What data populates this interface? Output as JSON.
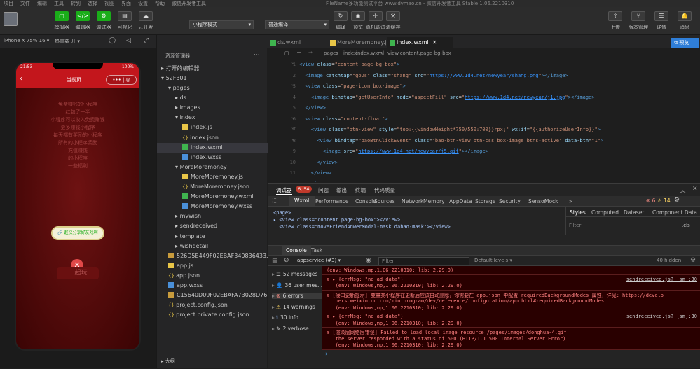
{
  "menubar": {
    "items": [
      "项目",
      "文件",
      "编辑",
      "工具",
      "转到",
      "选择",
      "视图",
      "界面",
      "设置",
      "帮助",
      "微信开发者工具"
    ],
    "title": "FileName多功能测试平台 www.dymao.cn - 微信开发者工具 Stable 1.06.2210310"
  },
  "toolbar": {
    "avatar": "avatar",
    "left_buttons": [
      {
        "icon": "▢",
        "label": "模拟器"
      },
      {
        "icon": "</>",
        "label": "编辑器"
      },
      {
        "icon": "⚙",
        "label": "调试器"
      },
      {
        "icon": "▤",
        "label": "可视化"
      },
      {
        "icon": "☁",
        "label": "云开发"
      }
    ],
    "mode_select": "小程序模式",
    "compile_select": "普通编译",
    "mid_buttons": [
      {
        "icon": "↻",
        "label": "编译"
      },
      {
        "icon": "◉",
        "label": "预览"
      },
      {
        "icon": "✈",
        "label": "真机调试"
      },
      {
        "icon": "⚒",
        "label": "清缓存"
      }
    ],
    "right_buttons": [
      {
        "icon": "⇪",
        "label": "上传"
      },
      {
        "icon": "⑂",
        "label": "版本管理"
      },
      {
        "icon": "☰",
        "label": "详情"
      },
      {
        "icon": "🔔",
        "label": "消息"
      }
    ]
  },
  "simulator": {
    "device": "iPhone X 75% 16 ▾",
    "network": "热重载 开 ▾",
    "status_time": "21:53",
    "status_batt": "100%",
    "nav_title": "当前页",
    "texts": [
      "免费赚钱的小程序",
      "红包了一半",
      "小程序可以收入免费赚钱",
      "更多赚钱小程序",
      "每天都有奖励的小程序",
      "所有的小程序奖励",
      "充值赚钱",
      "的小程序",
      "一些福利"
    ],
    "share_btn": "🔗 赶快分享好友戏啊",
    "bottom_btn": "一起玩"
  },
  "explorer": {
    "header": "资源管理器",
    "more": "···",
    "open_editors": "打开的编辑器",
    "project": "52F301",
    "tree": [
      {
        "depth": 1,
        "type": "folder",
        "open": true,
        "name": "pages"
      },
      {
        "depth": 2,
        "type": "folder",
        "open": false,
        "name": "ds"
      },
      {
        "depth": 2,
        "type": "folder",
        "open": false,
        "name": "images"
      },
      {
        "depth": 2,
        "type": "folder",
        "open": true,
        "name": "index"
      },
      {
        "depth": 3,
        "type": "js",
        "name": "index.js"
      },
      {
        "depth": 3,
        "type": "json",
        "name": "index.json"
      },
      {
        "depth": 3,
        "type": "wxml",
        "name": "index.wxml",
        "selected": true
      },
      {
        "depth": 3,
        "type": "wxss",
        "name": "index.wxss"
      },
      {
        "depth": 2,
        "type": "folder",
        "open": true,
        "name": "MoreMoremoney"
      },
      {
        "depth": 3,
        "type": "js",
        "name": "MoreMoremoney.js"
      },
      {
        "depth": 3,
        "type": "json",
        "name": "MoreMoremoney.json"
      },
      {
        "depth": 3,
        "type": "wxml",
        "name": "MoreMoremoney.wxml"
      },
      {
        "depth": 3,
        "type": "wxss",
        "name": "MoreMoremoney.wxss"
      },
      {
        "depth": 2,
        "type": "folder",
        "open": false,
        "name": "mywish"
      },
      {
        "depth": 2,
        "type": "folder",
        "open": false,
        "name": "sendreceived"
      },
      {
        "depth": 2,
        "type": "folder",
        "open": false,
        "name": "template"
      },
      {
        "depth": 2,
        "type": "folder",
        "open": false,
        "name": "wishdetail"
      },
      {
        "depth": 1,
        "type": "img",
        "name": "526D5E449F02EBAF340836433..."
      },
      {
        "depth": 1,
        "type": "js",
        "name": "app.js"
      },
      {
        "depth": 1,
        "type": "json",
        "name": "app.json"
      },
      {
        "depth": 1,
        "type": "wxss",
        "name": "app.wxss"
      },
      {
        "depth": 1,
        "type": "img",
        "name": "C15640D09F02EBAFA73028D76..."
      },
      {
        "depth": 1,
        "type": "json",
        "name": "project.config.json"
      },
      {
        "depth": 1,
        "type": "json",
        "name": "project.private.config.json"
      }
    ],
    "outline": "大纲"
  },
  "editor": {
    "tabs": [
      {
        "name": "ds.wxml",
        "type": "wxml"
      },
      {
        "name": "MoreMoremoney.js",
        "type": "js"
      },
      {
        "name": "index.wxml",
        "type": "wxml",
        "active": true,
        "close": "✕"
      }
    ],
    "breadcrumb": [
      "pages",
      "index",
      "index.wxml",
      "view.content.page-bg-box"
    ],
    "lines": [
      {
        "n": "1",
        "html": "<span class='t'>&lt;view</span> <span class='a'>class</span>=<span class='s'>\"content page-bg-box\"</span><span class='t'>&gt;</span>"
      },
      {
        "n": "2",
        "html": "&nbsp;&nbsp;<span class='t'>&lt;image</span> <span class='a'>catchtap</span>=<span class='s'>\"goDs\"</span> <span class='a'>class</span>=<span class='s'>\"shang\"</span> <span class='a'>src</span>=<span class='s'>\"</span><span class='l'>https://www.1d4.net/newyear/shang.png</span><span class='s'>\"</span><span class='t'>&gt;&lt;/image&gt;</span>"
      },
      {
        "n": "3",
        "html": "&nbsp;&nbsp;<span class='t'>&lt;view</span> <span class='a'>class</span>=<span class='s'>\"page-icon box-image\"</span><span class='t'>&gt;</span>"
      },
      {
        "n": "4",
        "html": "&nbsp;&nbsp;&nbsp;&nbsp;<span class='t'>&lt;image</span> <span class='a'>bindtap</span>=<span class='s'>\"getUserInfo\"</span> <span class='a'>mode</span>=<span class='s'>\"aspectFill\"</span> <span class='a'>src</span>=<span class='s'>\"</span><span class='l'>https://www.1d4.net/newyear/j1.jpg</span><span class='s'>\"</span><span class='t'>&gt;&lt;/image&gt;</span>"
      },
      {
        "n": "5",
        "html": "&nbsp;&nbsp;<span class='t'>&lt;/view&gt;</span>"
      },
      {
        "n": "6",
        "html": "&nbsp;&nbsp;<span class='t'>&lt;view</span> <span class='a'>class</span>=<span class='s'>\"content-float\"</span><span class='t'>&gt;</span>"
      },
      {
        "n": "7",
        "html": "&nbsp;&nbsp;&nbsp;&nbsp;<span class='t'>&lt;view</span> <span class='a'>class</span>=<span class='s'>\"btn-view\"</span> <span class='a'>style</span>=<span class='s'>\"top:{{windowHeight*750/550:700}}rpx;\"</span> <span class='a'>wx:if</span>=<span class='s'>\"{{authorizeUserInfo}}\"</span><span class='t'>&gt;</span>"
      },
      {
        "n": "8",
        "html": "&nbsp;&nbsp;&nbsp;&nbsp;&nbsp;&nbsp;<span class='t'>&lt;view</span> <span class='a'>bindtap</span>=<span class='s'>\"baoBtnClickEvent\"</span> <span class='a'>class</span>=<span class='s'>\"bao-btn-view btn-css box-image btns-active\"</span> <span class='a'>data-btn</span>=<span class='s'>\"1\"</span><span class='t'>&gt;</span>"
      },
      {
        "n": "9",
        "html": "&nbsp;&nbsp;&nbsp;&nbsp;&nbsp;&nbsp;&nbsp;&nbsp;<span class='t'>&lt;image</span> <span class='a'>src</span>=<span class='s'>\"</span><span class='l'>https://www.1d4.net/newyear/j5.gif</span><span class='s'>\"</span><span class='t'>&gt;&lt;/image&gt;</span>"
      },
      {
        "n": "10",
        "html": "&nbsp;&nbsp;&nbsp;&nbsp;&nbsp;&nbsp;<span class='t'>&lt;/view&gt;</span>"
      },
      {
        "n": "11",
        "html": "&nbsp;&nbsp;&nbsp;&nbsp;<span class='t'>&lt;/view&gt;</span>"
      },
      {
        "n": "12",
        "html": "&nbsp;&nbsp;<span class='t'>&lt;/view&gt;</span>"
      }
    ]
  },
  "devtools": {
    "top_tabs": [
      "调试器",
      "问题",
      "输出",
      "终端",
      "代码质量"
    ],
    "badge": "6, 54",
    "panel_tabs": [
      "Wxml",
      "Performance",
      "Console",
      "Sources",
      "Network",
      "Memory",
      "AppData",
      "Storage",
      "Security",
      "Sensor",
      "Mock",
      "»"
    ],
    "err_count": "6",
    "warn_count": "14",
    "wxml_lines": [
      "<page>",
      "▸ <view class=\"content page-bg-box\"></view>",
      "  <view class=\"moveFriendAnwerModal-mask dabao-mask\"></view>"
    ],
    "style_tabs": [
      "Styles",
      "Computed",
      "Dataset",
      "Component Data"
    ],
    "filter_placeholder": "Filter",
    "cls": ".cls",
    "console_tabs": [
      "Console",
      "Task"
    ],
    "context": "appservice (#3)",
    "console_filter": "Filter",
    "levels": "Default levels ▾",
    "hidden": "40 hidden",
    "sidebar": [
      {
        "icon": "☰",
        "label": "52 messages",
        "color": "#cfcfcf"
      },
      {
        "icon": "👤",
        "label": "36 user mes...",
        "color": "#cfcfcf"
      },
      {
        "icon": "⊗",
        "label": "6 errors",
        "color": "#f28b82"
      },
      {
        "icon": "⚠",
        "label": "14 warnings",
        "color": "#fdd663"
      },
      {
        "icon": "ℹ",
        "label": "30 info",
        "color": "#8ab4f8"
      },
      {
        "icon": "✎",
        "label": "2 verbose",
        "color": "#cfcfcf"
      }
    ],
    "messages": [
      {
        "lines": [
          "(env: Windows,mp,1.06.2210310; lib: 2.29.0)"
        ],
        "src": ""
      },
      {
        "lines": [
          "⊗ ▸ {errMsg: \"no ad data\"}",
          "   (env: Windows,mp,1.06.2210310; lib: 2.29.0)"
        ],
        "src": "sendreceived.js? [sm]:30"
      },
      {
        "lines": [
          "⊗ [接口更新提示] 变量类小程序在更新后应该自动删除，你需要在 app.json 中配置 requiredBackgroundModes 属性，详见: https://develo",
          "   pers.weixin.qq.com/miniprogram/dev/reference/configuration/app.html#requiredBackgroundModes",
          "   (env: Windows,mp,1.06.2210310; lib: 2.29.0)"
        ],
        "src": ""
      },
      {
        "lines": [
          "⊗ ▸ {errMsg: \"no ad data\"}",
          "   (env: Windows,mp,1.06.2210310; lib: 2.29.0)"
        ],
        "src": "sendreceived.js? [sm]:30"
      },
      {
        "lines": [
          "⊗ [渲染层网络层错误] Failed to load local image resource /pages/images/donghua-4.gif",
          "   the server responded with a status of 500 (HTTP/1.1 500 Internal Server Error)",
          "   (env: Windows,mp,1.06.2210310; lib: 2.29.0)"
        ],
        "src": ""
      }
    ],
    "prompt": "›"
  },
  "colors": {
    "accent": "#1aad19",
    "error_bg": "#290000",
    "phone_red": "#c3161c",
    "selected": "#37373d"
  }
}
